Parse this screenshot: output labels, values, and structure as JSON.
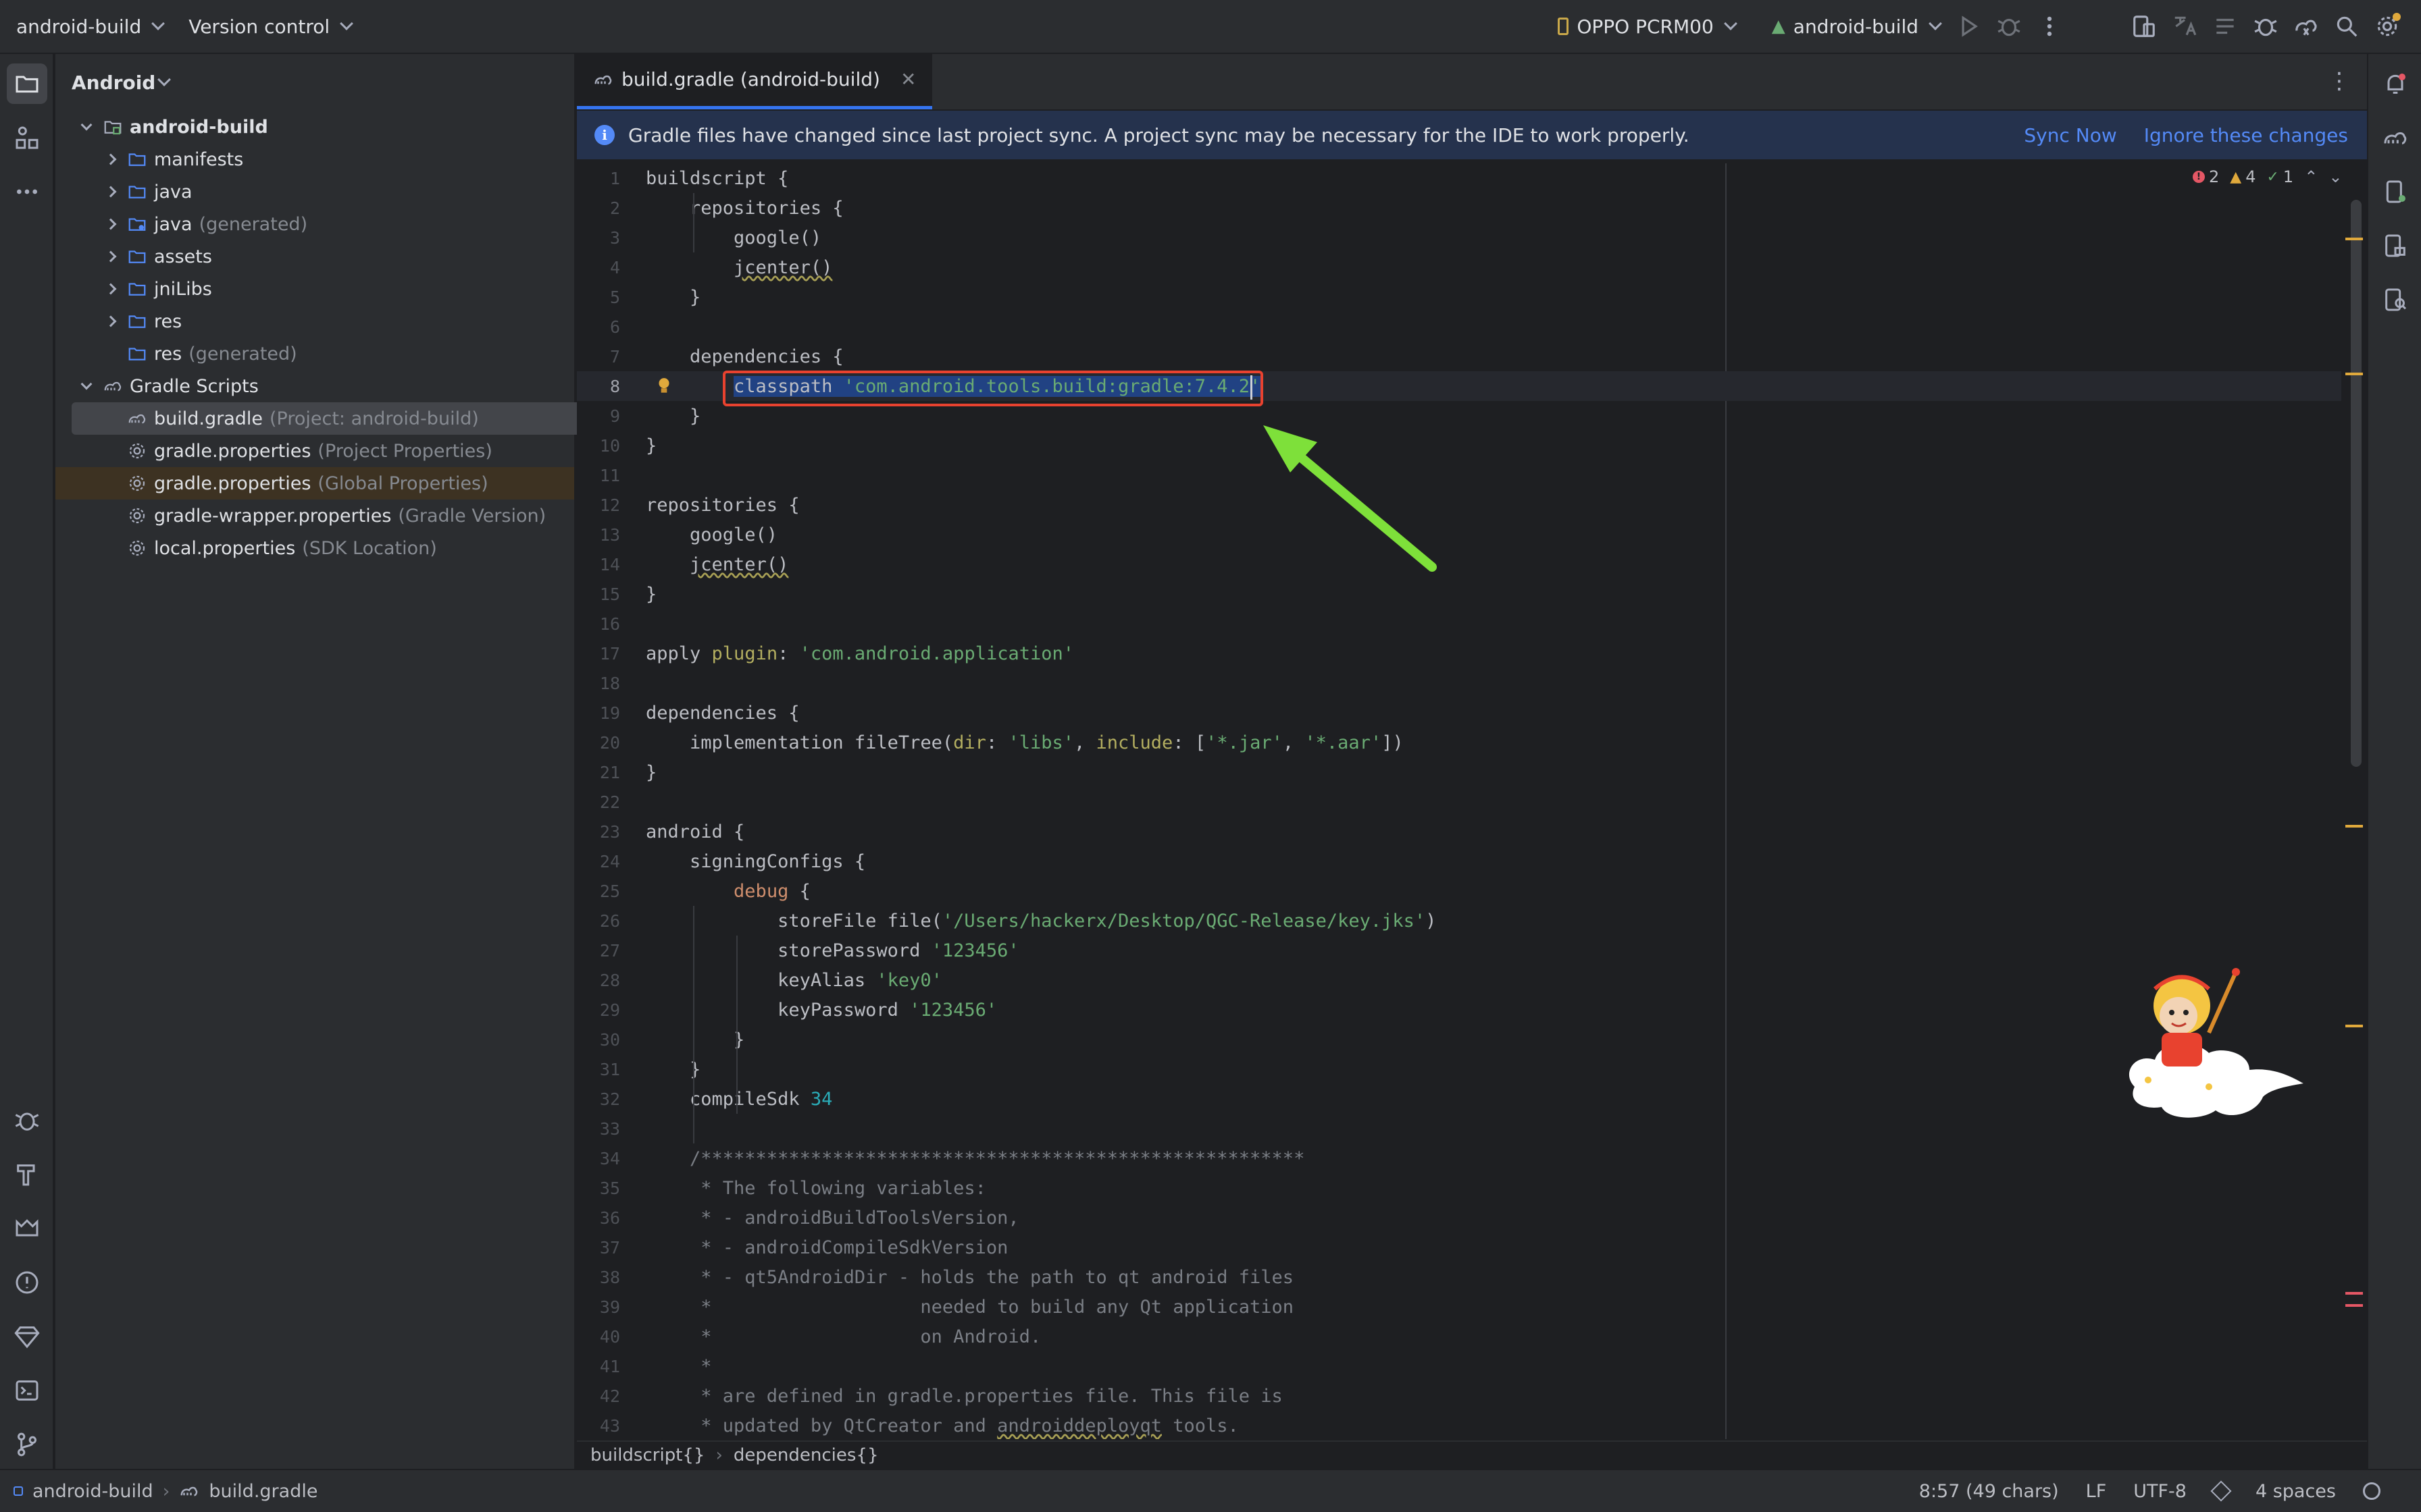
{
  "titlebar": {
    "project": "android-build",
    "vcs": "Version control",
    "device": "OPPO PCRM00",
    "run_config": "android-build"
  },
  "project_panel": {
    "view": "Android",
    "tree": [
      {
        "label": "android-build",
        "suffix": "",
        "indent": 0,
        "expanded": true,
        "icon": "module-icon",
        "bold": true
      },
      {
        "label": "manifests",
        "suffix": "",
        "indent": 1,
        "expanded": false,
        "icon": "folder-icon"
      },
      {
        "label": "java",
        "suffix": "",
        "indent": 1,
        "expanded": false,
        "icon": "folder-icon"
      },
      {
        "label": "java",
        "suffix": "(generated)",
        "indent": 1,
        "expanded": false,
        "icon": "folder-generated-icon"
      },
      {
        "label": "assets",
        "suffix": "",
        "indent": 1,
        "expanded": false,
        "icon": "folder-icon"
      },
      {
        "label": "jniLibs",
        "suffix": "",
        "indent": 1,
        "expanded": false,
        "icon": "folder-icon"
      },
      {
        "label": "res",
        "suffix": "",
        "indent": 1,
        "expanded": false,
        "icon": "folder-icon"
      },
      {
        "label": "res",
        "suffix": "(generated)",
        "indent": 1,
        "expanded": null,
        "icon": "folder-icon"
      },
      {
        "label": "Gradle Scripts",
        "suffix": "",
        "indent": 0,
        "expanded": true,
        "icon": "gradle-icon"
      },
      {
        "label": "build.gradle",
        "suffix": "(Project: android-build)",
        "indent": 1,
        "expanded": null,
        "icon": "gradle-icon",
        "selected": true
      },
      {
        "label": "gradle.properties",
        "suffix": "(Project Properties)",
        "indent": 1,
        "expanded": null,
        "icon": "gear-icon"
      },
      {
        "label": "gradle.properties",
        "suffix": "(Global Properties)",
        "indent": 1,
        "expanded": null,
        "icon": "gear-icon",
        "highlight": true
      },
      {
        "label": "gradle-wrapper.properties",
        "suffix": "(Gradle Version)",
        "indent": 1,
        "expanded": null,
        "icon": "gear-icon"
      },
      {
        "label": "local.properties",
        "suffix": "(SDK Location)",
        "indent": 1,
        "expanded": null,
        "icon": "gear-icon"
      }
    ]
  },
  "editor": {
    "tab_label": "build.gradle (android-build)",
    "banner": {
      "message": "Gradle files have changed since last project sync. A project sync may be necessary for the IDE to work properly.",
      "sync_now": "Sync Now",
      "ignore": "Ignore these changes"
    },
    "inspections": {
      "errors": "2",
      "warnings": "4",
      "weak": "1"
    },
    "current_line": 8,
    "lines": [
      [
        [
          "t",
          "buildscript {"
        ]
      ],
      [
        [
          "t",
          "    repositories {"
        ]
      ],
      [
        [
          "t",
          "        google()"
        ]
      ],
      [
        [
          "t",
          "        "
        ],
        [
          "u",
          "jcenter()"
        ]
      ],
      [
        [
          "t",
          "    }"
        ]
      ],
      [
        [
          "t",
          ""
        ]
      ],
      [
        [
          "t",
          "    dependencies {"
        ]
      ],
      [
        [
          "t",
          "        "
        ],
        [
          "sel",
          "classpath "
        ],
        [
          "selstr",
          "'com.android.tools.build:gradle:7.4.2'"
        ]
      ],
      [
        [
          "t",
          "    }"
        ]
      ],
      [
        [
          "t",
          "}"
        ]
      ],
      [
        [
          "t",
          ""
        ]
      ],
      [
        [
          "t",
          "repositories {"
        ]
      ],
      [
        [
          "t",
          "    google()"
        ]
      ],
      [
        [
          "t",
          "    "
        ],
        [
          "u",
          "jcenter()"
        ]
      ],
      [
        [
          "t",
          "}"
        ]
      ],
      [
        [
          "t",
          ""
        ]
      ],
      [
        [
          "t",
          "apply "
        ],
        [
          "p",
          "plugin"
        ],
        [
          "t",
          ": "
        ],
        [
          "s",
          "'com.android.application'"
        ]
      ],
      [
        [
          "t",
          ""
        ]
      ],
      [
        [
          "t",
          "dependencies {"
        ]
      ],
      [
        [
          "t",
          "    implementation fileTree("
        ],
        [
          "p",
          "dir"
        ],
        [
          "t",
          ": "
        ],
        [
          "s",
          "'libs'"
        ],
        [
          "t",
          ", "
        ],
        [
          "p",
          "include"
        ],
        [
          "t",
          ": ["
        ],
        [
          "s",
          "'*.jar'"
        ],
        [
          "t",
          ", "
        ],
        [
          "s",
          "'*.aar'"
        ],
        [
          "t",
          "])"
        ]
      ],
      [
        [
          "t",
          "}"
        ]
      ],
      [
        [
          "t",
          ""
        ]
      ],
      [
        [
          "t",
          "android {"
        ]
      ],
      [
        [
          "t",
          "    signingConfigs {"
        ]
      ],
      [
        [
          "t",
          "        "
        ],
        [
          "k",
          "debug"
        ],
        [
          "t",
          " {"
        ]
      ],
      [
        [
          "t",
          "            storeFile file("
        ],
        [
          "s",
          "'/Users/hackerx/Desktop/QGC-Release/key.jks'"
        ],
        [
          "t",
          ")"
        ]
      ],
      [
        [
          "t",
          "            storePassword "
        ],
        [
          "s",
          "'123456'"
        ]
      ],
      [
        [
          "t",
          "            keyAlias "
        ],
        [
          "s",
          "'key0'"
        ]
      ],
      [
        [
          "t",
          "            keyPassword "
        ],
        [
          "s",
          "'123456'"
        ]
      ],
      [
        [
          "t",
          "        }"
        ]
      ],
      [
        [
          "t",
          "    }"
        ]
      ],
      [
        [
          "t",
          "    compileSdk "
        ],
        [
          "n",
          "34"
        ]
      ],
      [
        [
          "t",
          ""
        ]
      ],
      [
        [
          "c",
          "    /*******************************************************"
        ]
      ],
      [
        [
          "c",
          "     * The following variables:"
        ]
      ],
      [
        [
          "c",
          "     * - androidBuildToolsVersion,"
        ]
      ],
      [
        [
          "c",
          "     * - androidCompileSdkVersion"
        ]
      ],
      [
        [
          "c",
          "     * - qt5AndroidDir - holds the path to qt android files"
        ]
      ],
      [
        [
          "c",
          "     *                   needed to build any Qt application"
        ]
      ],
      [
        [
          "c",
          "     *                   on Android."
        ]
      ],
      [
        [
          "c",
          "     *"
        ]
      ],
      [
        [
          "c",
          "     * are defined in gradle.properties file. This file is"
        ]
      ],
      [
        [
          "c",
          "     * updated by QtCreator and "
        ],
        [
          "cu",
          "androiddeployqt"
        ],
        [
          "c",
          " tools."
        ]
      ]
    ]
  },
  "breadcrumbs": [
    "buildscript{}",
    "dependencies{}"
  ],
  "statusbar": {
    "path": [
      "android-build",
      "build.gradle"
    ],
    "position": "8:57 (49 chars)",
    "line_sep": "LF",
    "encoding": "UTF-8",
    "indent": "4 spaces"
  },
  "colors": {
    "accent": "#3574f0",
    "highlight_box": "#e8422f",
    "arrow": "#7ee03a"
  }
}
